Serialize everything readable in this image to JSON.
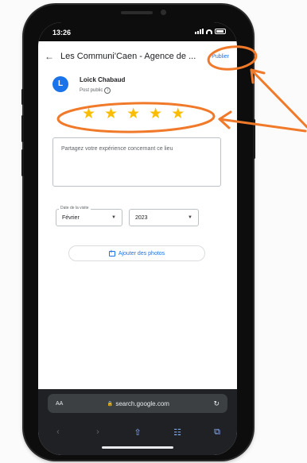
{
  "status_bar": {
    "time": "13:26"
  },
  "header": {
    "back_icon": "arrow-left-icon",
    "title": "Les Communi'Caen - Agence de ...",
    "publish_label": "Publier"
  },
  "user": {
    "avatar_letter": "L",
    "name": "Loick Chabaud",
    "visibility": "Post public",
    "info_icon": "info-icon"
  },
  "rating": {
    "stars": 5,
    "max": 5,
    "star_icon": "star-icon",
    "color": "#fbbc04"
  },
  "review": {
    "placeholder": "Partagez votre expérience concernant ce lieu"
  },
  "visit_date": {
    "label": "Date de la visite",
    "month": "Février",
    "year": "2023"
  },
  "photos": {
    "label": "Ajouter des photos",
    "icon": "add-photo-icon"
  },
  "browser": {
    "text_size_label": "AA",
    "url": "search.google.com",
    "lock_icon": "lock-icon",
    "reload_icon": "reload-icon"
  },
  "toolbar": {
    "items": [
      "back-icon",
      "forward-icon",
      "share-icon",
      "bookmarks-icon",
      "tabs-icon"
    ]
  },
  "colors": {
    "accent": "#1a73e8",
    "annotation": "#f07a2a"
  }
}
